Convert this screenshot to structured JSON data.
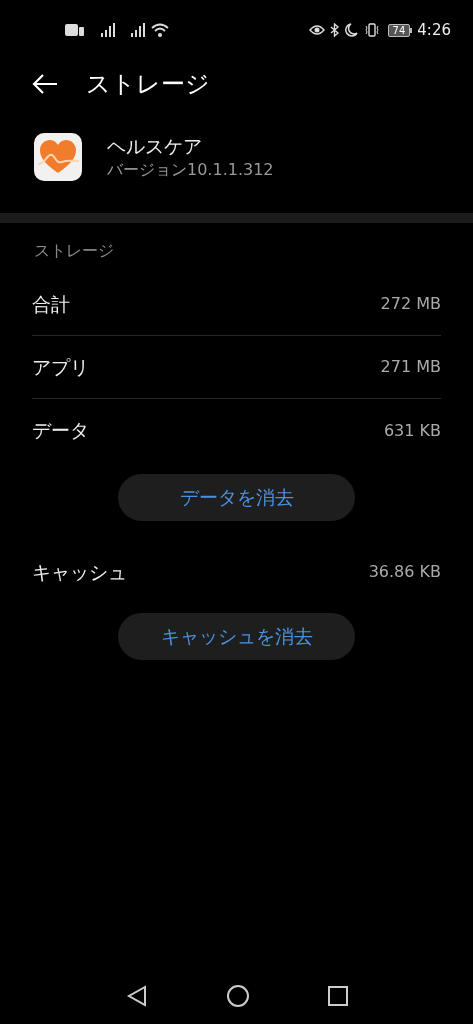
{
  "status_bar": {
    "battery": "74",
    "time": "4:26"
  },
  "header": {
    "title": "ストレージ"
  },
  "app": {
    "name": "ヘルスケア",
    "version": "バージョン10.1.1.312"
  },
  "section_title": "ストレージ",
  "rows": [
    {
      "label": "合計",
      "value": "272 MB"
    },
    {
      "label": "アプリ",
      "value": "271 MB"
    },
    {
      "label": "データ",
      "value": "631 KB"
    }
  ],
  "clear_data_button": "データを消去",
  "cache": {
    "label": "キャッシュ",
    "value": "36.86 KB"
  },
  "clear_cache_button": "キャッシュを消去"
}
